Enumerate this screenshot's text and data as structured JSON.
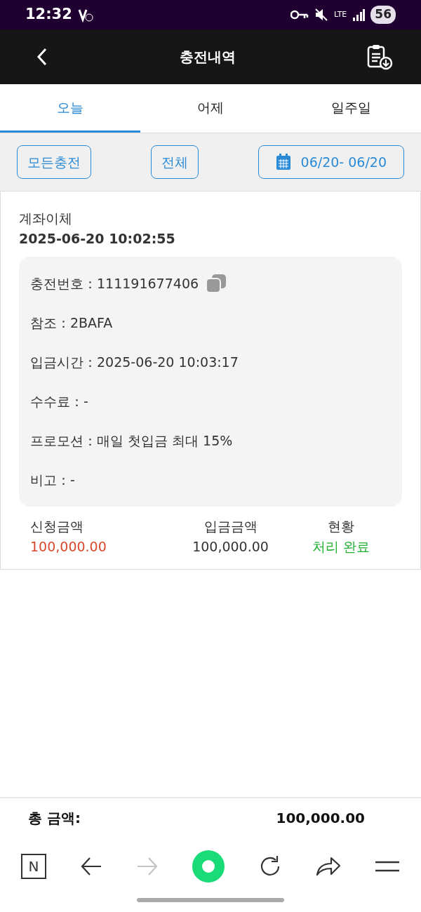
{
  "status_bar": {
    "time": "12:32",
    "network": "LTE",
    "battery": "56"
  },
  "app_bar": {
    "title": "충전내역"
  },
  "tabs": [
    {
      "label": "오늘",
      "selected": true
    },
    {
      "label": "어제",
      "selected": false
    },
    {
      "label": "일주일",
      "selected": false
    }
  ],
  "filters": {
    "type_button": "모든충전",
    "scope_button": "전체",
    "date_range": "06/20- 06/20"
  },
  "records": [
    {
      "method": "계좌이체",
      "created": "2025-06-20 10:02:55",
      "details": [
        {
          "text": "충전번호：111191677406",
          "copyable": true
        },
        {
          "text": "참조：2BAFA",
          "copyable": false
        },
        {
          "text": "입금시간：2025-06-20 10:03:17",
          "copyable": false
        },
        {
          "text": "수수료：-",
          "copyable": false
        },
        {
          "text": "프로모션：매일 첫입금 최대 15%",
          "copyable": false
        },
        {
          "text": "비고：-",
          "copyable": false
        }
      ],
      "requested_label": "신청금액",
      "requested": "100,000.00",
      "deposited_label": "입금금액",
      "deposited": "100,000.00",
      "status_label": "현황",
      "status": {
        "text": "처리 완료",
        "kind": "completed"
      }
    }
  ],
  "total": {
    "label": "총 금액:",
    "value": "100,000.00"
  },
  "browser_bar": [
    {
      "kind": "home",
      "text": "N",
      "disabled": false
    },
    {
      "kind": "back",
      "disabled": false
    },
    {
      "kind": "forward",
      "disabled": true
    },
    {
      "kind": "center",
      "disabled": false
    },
    {
      "kind": "reload",
      "disabled": false
    },
    {
      "kind": "share",
      "disabled": false
    },
    {
      "kind": "menu",
      "disabled": false
    }
  ]
}
